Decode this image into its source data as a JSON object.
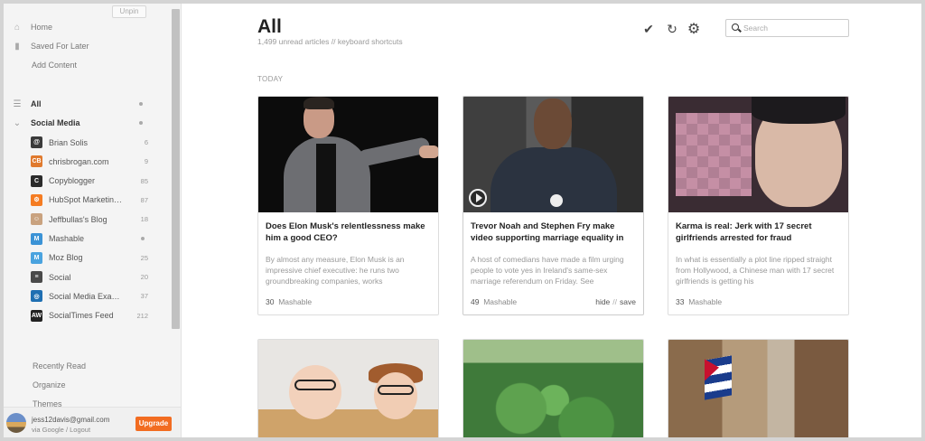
{
  "sidebar": {
    "unpin": "Unpin",
    "nav": [
      {
        "label": "Home"
      },
      {
        "label": "Saved For Later"
      },
      {
        "label": "Add Content"
      }
    ],
    "all_label": "All",
    "section_label": "Social Media",
    "feeds": [
      {
        "name": "Brian Solis",
        "count": "6",
        "color": "#3b3b3b",
        "glyph": "@"
      },
      {
        "name": "chrisbrogan.com",
        "count": "9",
        "color": "#e07a2e",
        "glyph": "CB"
      },
      {
        "name": "Copyblogger",
        "count": "85",
        "color": "#2b2b2b",
        "glyph": "C"
      },
      {
        "name": "HubSpot Marketing ...",
        "count": "87",
        "color": "#f57c22",
        "glyph": "⚙"
      },
      {
        "name": "Jeffbullas's Blog",
        "count": "18",
        "color": "#c9a27f",
        "glyph": "☺"
      },
      {
        "name": "Mashable",
        "count": "",
        "color": "#3b93d6",
        "glyph": "M"
      },
      {
        "name": "Moz Blog",
        "count": "25",
        "color": "#4aa3df",
        "glyph": "M"
      },
      {
        "name": "Social",
        "count": "20",
        "color": "#4a4a4a",
        "glyph": "≡"
      },
      {
        "name": "Social Media Exami...",
        "count": "37",
        "color": "#1f6fb2",
        "glyph": "◎"
      },
      {
        "name": "SocialTimes Feed",
        "count": "212",
        "color": "#222222",
        "glyph": "AW"
      }
    ],
    "bottom_links": [
      "Recently Read",
      "Organize",
      "Themes"
    ],
    "account": {
      "email": "jess12davis@gmail.com",
      "sub": "via Google / Logout",
      "upgrade": "Upgrade"
    }
  },
  "header": {
    "title": "All",
    "subtitle": "1,499 unread articles  //  keyboard shortcuts",
    "search_placeholder": "Search"
  },
  "section_today": "TODAY",
  "cards": [
    {
      "title": "Does Elon Musk's relentlessness make him a good CEO?",
      "excerpt": "By almost any measure, Elon Musk is an impressive chief executive: he runs two groundbreaking companies, works",
      "count": "30",
      "source": "Mashable"
    },
    {
      "title": "Trevor Noah and Stephen Fry make video supporting marriage equality in",
      "excerpt": "A host of comedians have made a film urging people to vote yes in Ireland's same-sex marriage referendum on Friday. See",
      "count": "49",
      "source": "Mashable",
      "hide": "hide",
      "save": "save"
    },
    {
      "title": "Karma is real: Jerk with 17 secret girlfriends arrested for fraud",
      "excerpt": "In what is essentially a plot line ripped straight from Hollywood, a Chinese man with 17 secret girlfriends is getting his",
      "count": "33",
      "source": "Mashable"
    }
  ],
  "colors": {
    "accent": "#f26c21",
    "sidebar_bg": "#f4f4f4"
  }
}
